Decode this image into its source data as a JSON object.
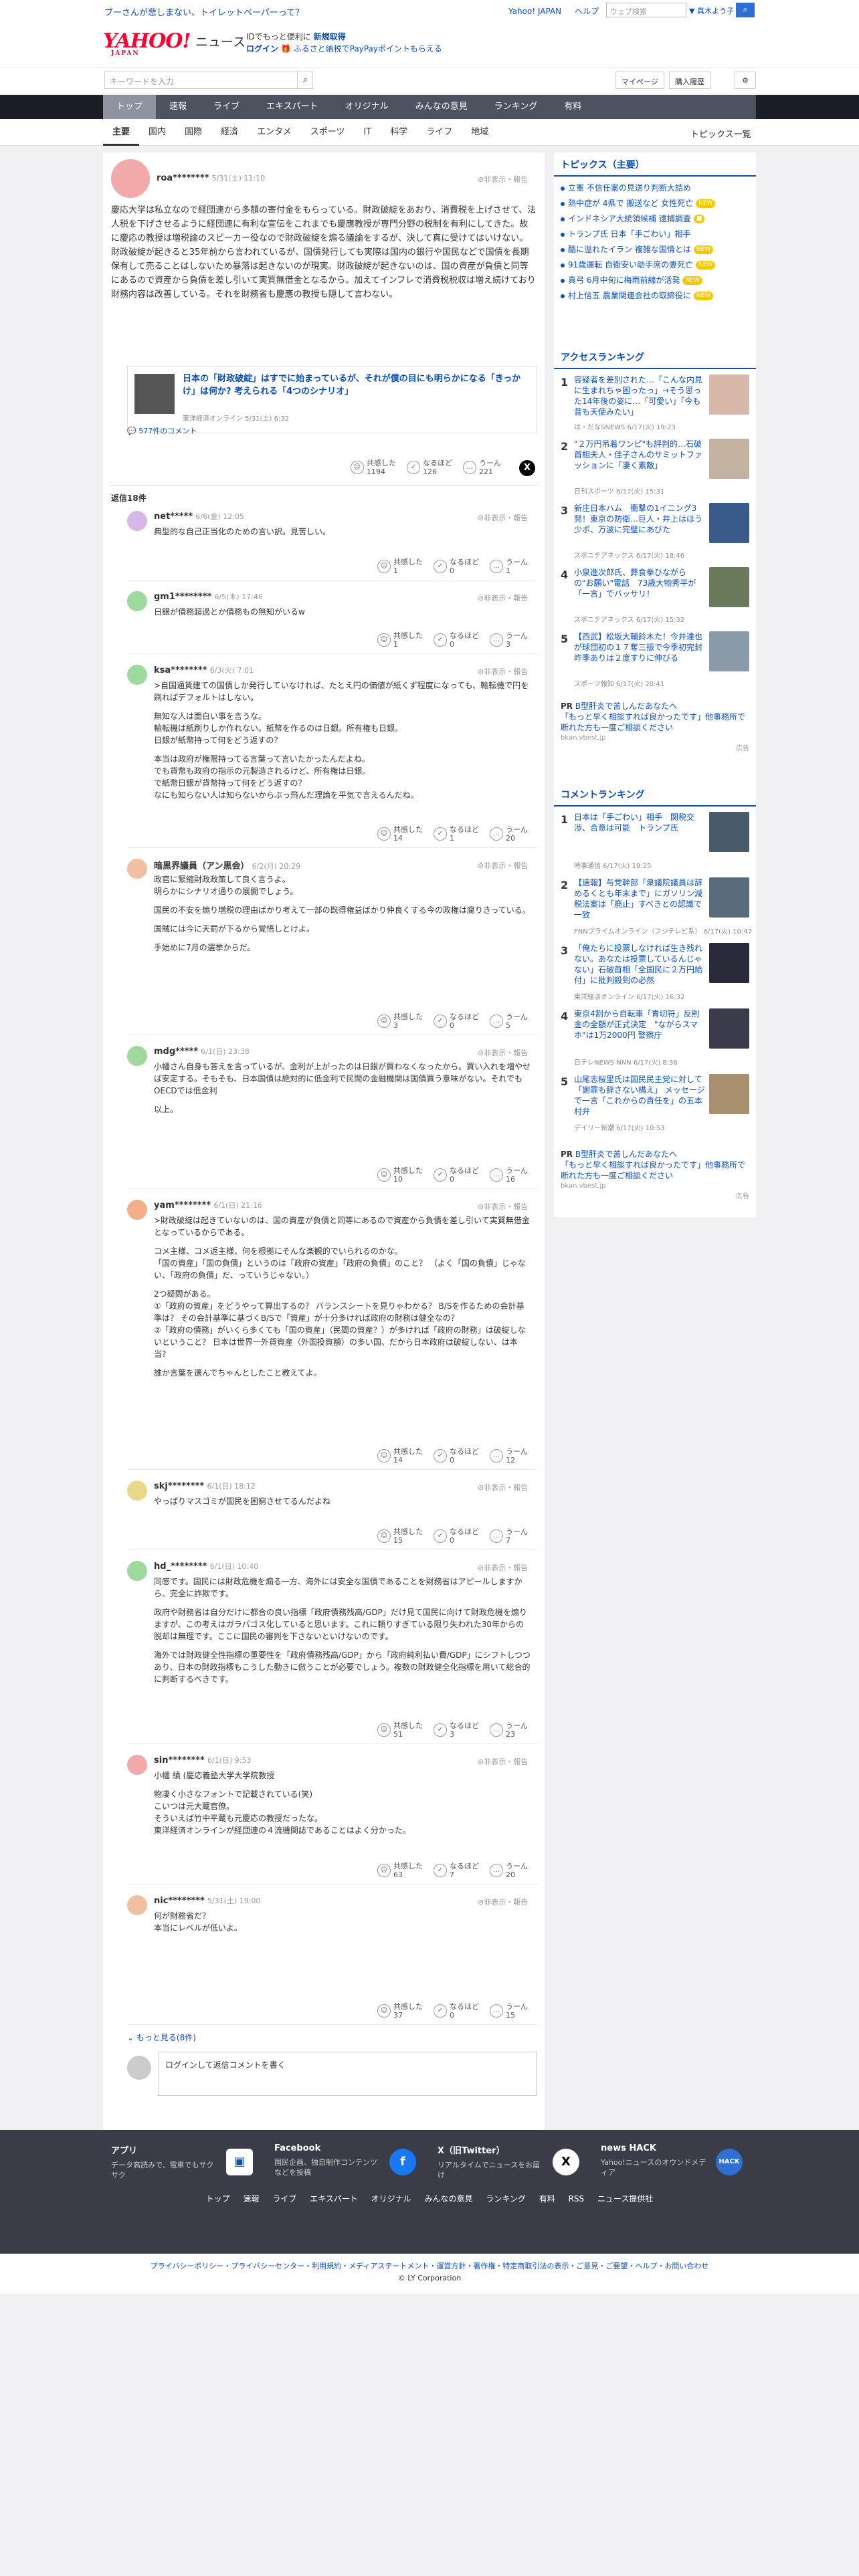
{
  "top": {
    "promo": "ブーさんが悲しまない、トイレットペーパーって？",
    "links": [
      "Yahoo! JAPAN",
      "ヘルプ"
    ],
    "search_placeholder": "ウェブ検索",
    "search_scope": "▼ 真木よう子"
  },
  "header": {
    "logo": "YAHOO!",
    "logo_sub": "JAPAN",
    "section": "ニュース",
    "promo_line1_prefix": "IDでもっと便利に",
    "promo_line1_link": "新規取得",
    "promo_line2_login": "ログイン",
    "promo_line2_text": "ふるさと納税でPayPayポイントもらえる"
  },
  "search": {
    "placeholder": "キーワードを入力",
    "mypage": "マイページ",
    "history": "購入履歴"
  },
  "nav": [
    "トップ",
    "速報",
    "ライブ",
    "エキスパート",
    "オリジナル",
    "みんなの意見",
    "ランキング",
    "有料"
  ],
  "subnav": [
    "主要",
    "国内",
    "国際",
    "経済",
    "エンタメ",
    "スポーツ",
    "IT",
    "科学",
    "ライフ",
    "地域"
  ],
  "subnav_all": "トピックス一覧",
  "main_post": {
    "user": "roa********",
    "date": "5/31(土) 11:10",
    "report": "非表示・報告",
    "text": "慶応大学は私立なので経団連から多額の寄付金をもらっている。財政破綻をあおり、消費税を上げさせて、法人税を下げさせるように経団連に有利な宣伝をこれまでも慶應教授が専門分野の税制を有利にしてきた。故に慶応の教授は増税論のスピーカー役なので財政破綻を煽る議論をするが、決して真に受けてはいけない。財政破綻が起きると35年前から言われているが、国債発行しても実際は国内の銀行や国民などで国債を長期保有して売ることはしないため暴落は起きないのが現実。財政破綻が起きないのは、国の資産が負債と同等にあるので資産から負債を差し引いて実質無借金となるから。加えてインフレで消費税税収は増え続けており財務内容は改善している。それを財務省も慶應の教授も隠して言わない。",
    "article_title": "日本の「財政破綻」はすでに始まっているが、それが僕の目にも明らかになる「きっかけ」は何か? 考えられる「4つのシナリオ」",
    "article_source": "東洋経済オンライン 5/31(土) 6:32",
    "comments_link": "577件のコメント",
    "reactions": [
      {
        "label": "共感した",
        "count": "1194"
      },
      {
        "label": "なるほど",
        "count": "126"
      },
      {
        "label": "うーん",
        "count": "221"
      }
    ],
    "x_label": "X"
  },
  "replies_header": "返信18件",
  "replies": [
    {
      "user": "net*****",
      "date": "6/6(金) 12:05",
      "text": [
        "典型的な自己正当化のための言い訳。見苦しい。"
      ],
      "r": [
        "1",
        "0",
        "1"
      ]
    },
    {
      "user": "gm1********",
      "date": "6/5(木) 17:46",
      "text": [
        "日銀が債務超過とか債務もの無知がいるw"
      ],
      "r": [
        "1",
        "0",
        "3"
      ]
    },
    {
      "user": "ksa********",
      "date": "6/3(火) 7:01",
      "text": [
        ">自国通貨建ての国債しか発行していなければ、たとえ円の価値が紙くず程度になっても、輸転機で円を刷ればデフォルトはしない。",
        "",
        "無知な人は面白い事を言うな。",
        "輸転機は紙刷りしか作れない。紙幣を作るのは日銀。所有権も日銀。",
        "日銀が紙幣持って何をどう返すの？",
        "",
        "本当は政府が権限持ってる言葉って言いたかったんだよね。",
        "でも貨幣も政府の指示の元製造されるけど、所有権は日銀。",
        "で紙幣日銀が貨幣持って何をどう返すの？",
        "なにも知らない人は知らないからぶっ飛んだ理論を平気で言えるんだね。"
      ],
      "r": [
        "14",
        "1",
        "20"
      ]
    },
    {
      "user": "暗黒界議員（アン黒会）",
      "date": "6/2(月) 20:29",
      "text": [
        "政官に緊縮財政政策して良く言うよ。",
        "明らかにシナリオ通りの展開でしょう。",
        "",
        "国民の不安を煽り増税の理由ばかり考えて一部の既得権益ばかり仲良くする今の政権は腐りきっている。",
        "",
        "国賊には今に天罰が下るから覚悟しとけよ。",
        "",
        "手始めに7月の選挙からだ。"
      ],
      "r": [
        "3",
        "0",
        "5"
      ]
    },
    {
      "user": "mdg*****",
      "date": "6/1(日) 23:38",
      "text": [
        "小幡さん自身も答えを言っているが、金利が上がったのは日銀が買わなくなったから。買い入れを増やせば安定する。そもそも、日本国債は絶対的に低金利で民間の金融機関は国債買う意味がない。それでもOECDでは低金利",
        "",
        "以上。"
      ],
      "r": [
        "10",
        "0",
        "16"
      ]
    },
    {
      "user": "yam********",
      "date": "6/1(日) 21:16",
      "text": [
        ">財政破綻は起きていないのは、国の資産が負債と同等にあるので資産から負債を差し引いて実質無借金となっているからである。",
        "",
        "コメ主様、コメ返主様、何を根拠にそんな楽観的でいられるのかな。",
        "「国の資産」「国の負債」というのは「政府の資産」「政府の負債」のこと？ （よく「国の負債」じゃない、「政府の負債」だ、っていうじゃない。）",
        "",
        "2つ疑問がある。",
        "①「政府の資産」をどうやって算出するの？ バランスシートを見りゃわかる？ B/Sを作るための会計基準は？ その会計基準に基づくB/Sで「資産」が十分多ければ政府の財務は健全なの？",
        "②「政府の債務」がいくら多くても「国の資産」（民間の資産？）が多ければ「政府の財務」は破綻しないということ？ 日本は世界一外貨資産（外国投資額）の多い国、だから日本政府は破綻しない、は本当？",
        "",
        "誰か言葉を選んでちゃんとしたこと教えてよ。"
      ],
      "r": [
        "14",
        "0",
        "12"
      ]
    },
    {
      "user": "skj********",
      "date": "6/1(日) 18:12",
      "text": [
        "やっぱりマスゴミが国民を困窮させてるんだよね"
      ],
      "r": [
        "15",
        "0",
        "7"
      ]
    },
    {
      "user": "hd_********",
      "date": "6/1(日) 10:40",
      "text": [
        "同感です。国民には財政危機を煽る一方、海外には安全な国債であることを財務省はアピールしますから、完全に詐欺です。",
        "",
        "政府や財務省は自分だけに都合の良い指標「政府債務残高/GDP」だけ見て国民に向けて財政危機を煽りますが、この考えはガラパゴス化していると思います。これに頼りすぎている限り失われた30年からの脱却は無理です。ここに国民の審判を下さないといけないのです。",
        "",
        "海外では財政健全性指標の重要性を「政府債務残高/GDP」から「政府純利払い費/GDP」にシフトしつつあり、日本の財政指標もこうした動きに倣うことが必要でしょう。複数の財政健全化指標を用いて総合的に判断するべきです。"
      ],
      "r": [
        "51",
        "3",
        "23"
      ]
    },
    {
      "user": "sin********",
      "date": "6/1(日) 9:53",
      "text": [
        "小幡 績 (慶応義塾大学大学院教授",
        "",
        "物凄く小さなフォントで記載されている(笑)",
        "こいつは元大蔵官僚。",
        "そういえば竹中平蔵も元慶応の教授だったな。",
        "東洋経済オンラインが経団連の４流機関誌であることはよく分かった。"
      ],
      "r": [
        "63",
        "7",
        "20"
      ]
    },
    {
      "user": "nic********",
      "date": "5/31(土) 19:00",
      "text": [
        "何が財務省だ？",
        "本当にレベルが低いよ。"
      ],
      "r": [
        "37",
        "0",
        "15"
      ]
    }
  ],
  "more_replies": "もっと見る(8件)",
  "reply_box": "ログインして返信コメントを書く",
  "sidebar": {
    "topics_title": "トピックス（主要）",
    "topics": [
      {
        "t": "立憲 不信任案の見送り判断大詰め",
        "badge": ""
      },
      {
        "t": "熱中症が 4県で 搬送など 女性死亡",
        "badge": "NEW"
      },
      {
        "t": "インドネシア大統領候補 逮捕調査",
        "badge": "■"
      },
      {
        "t": "トランプ氏 日本「手ごわい」相手",
        "badge": ""
      },
      {
        "t": "酷に溢れたイラン 複雑な国情とは",
        "badge": "NEW"
      },
      {
        "t": "91歳運転 自衛安い助手席の妻死亡",
        "badge": "NEW"
      },
      {
        "t": "真弓 6月中旬に梅雨前線が活発",
        "badge": "NEW"
      },
      {
        "t": "村上信五 農業関連会社の取締役に",
        "badge": "NEW"
      }
    ],
    "access_title": "アクセスランキング",
    "access": [
      {
        "n": "1",
        "t": "容疑者を差別された…「こんな内見に生まれちゃ困ったっ」→そう思った14年後の姿に…「可愛い」「今も昔も天使みたい」",
        "m": "は・だなSNEWS 6/17(火) 19:23"
      },
      {
        "n": "2",
        "t": "\"２万円吊着ワンピ\"も評判的…石破首相夫人・佳子さんのサミットファッションに「凄く素敵」",
        "m": "日刊スポーツ 6/17(火) 15:31"
      },
      {
        "n": "3",
        "t": "新庄日本ハム　衝撃の1イニング3発！東京の防衛…巨人・井上はほう少ポ、万波に完璧にあびた",
        "m": "スポニチアネックス 6/17(火) 18:46"
      },
      {
        "n": "4",
        "t": "小泉進次郎氏、葬食拳ひながらの\"お願い\"電話　73歳大物秀平が「一言」でバッサリ！",
        "m": "スポニチアネックス 6/17(火) 15:32"
      },
      {
        "n": "5",
        "t": "【西武】松坂大輔鈴木た！今井達也が球団初の１７奪三振で今季初完封　昨季ありは２度すりに伸びる",
        "m": "スポーツ報知 6/17(火) 20:41"
      }
    ],
    "pr1_title": "B型肝炎で苦しんだあなたへ",
    "pr1_text": "「もっと早く相談すれば良かったです」他事務所で断れた方も一度ご相談ください",
    "pr1_src": "bkan.vbest.jp",
    "comment_title": "コメントランキング",
    "comment": [
      {
        "n": "1",
        "t": "日本は「手ごわい」相手　関税交渉、合意は可能　トランプ氏",
        "m": "時事通信 6/17(火) 19:25"
      },
      {
        "n": "2",
        "t": "【速報】与党幹部「衆議院議員は辞めるくとも年末まで」にガソリン減税法案は「廃止」すべきとの認識で一致",
        "m": "FNNプライムオンライン（フジテレビ系） 6/17(火) 10:47"
      },
      {
        "n": "3",
        "t": "「俺たちに投票しなければ生き残れない。あなたは投票しているんじゃない」石破首相「全国民に２万円給付」に批判殺到の必然",
        "m": "東洋経済オンライン 6/17(火) 16:32"
      },
      {
        "n": "4",
        "t": "東京4割から自転車「青切符」反則金の全額が正式決定　\"ながらスマホ\"は1万2000円 警察庁",
        "m": "日テレNEWS NNN 6/17(火) 8:36"
      },
      {
        "n": "5",
        "t": "山尾志桜里氏は国民民主党に対して「謝罪も辞さない構え」 メッセージで一言「これからの責任を」の五本村弁",
        "m": "デイリー新潮 6/17(火) 10:53"
      }
    ],
    "pr2_title": "B型肝炎で苦しんだあなたへ",
    "pr2_text": "「もっと早く相談すれば良かったです」他事務所で断れた方も一度ご相談ください",
    "pr2_src": "bkan.vbest.jp",
    "ad_label": "広告"
  },
  "footer": {
    "cards": [
      {
        "t": "アプリ",
        "d": "データ高読みで、電車でもサクサク"
      },
      {
        "t": "Facebook",
        "d": "国民企画、独自制作コンテンツなどを投稿"
      },
      {
        "t": "X（旧Twitter）",
        "d": "リアルタイムでニュースをお届け"
      },
      {
        "t": "news HACK",
        "d": "Yahoo!ニュースのオウンドメディア"
      }
    ],
    "links": [
      "トップ",
      "速報",
      "ライブ",
      "エキスパート",
      "オリジナル",
      "みんなの意見",
      "ランキング",
      "有料",
      "RSS",
      "ニュース提供社"
    ],
    "legal_links": "プライバシーポリシー・プライバシーセンター・利用規約・メディアステートメント・運営方針・著作権・特定商取引法の表示・ご意見・ご要望・ヘルプ・お問い合わせ",
    "copyright": "© LY Corporation"
  },
  "colors": {
    "nav": "#4d5160",
    "accent": "#0b50b8",
    "brand": "#ff0033"
  }
}
